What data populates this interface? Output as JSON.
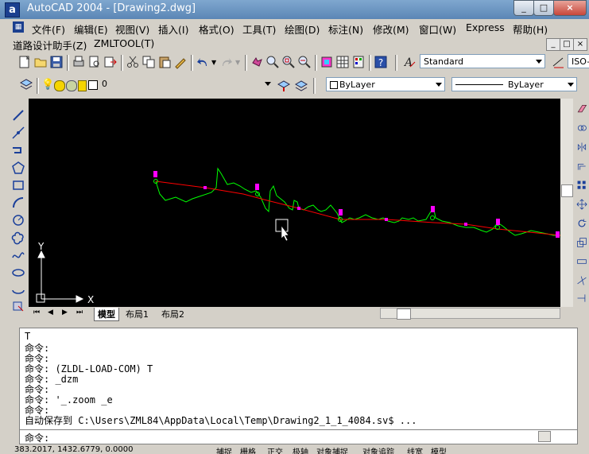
{
  "window": {
    "app_icon": "a",
    "title": "AutoCAD 2004 - [Drawing2.dwg]",
    "controls": [
      "_",
      "□",
      "×"
    ]
  },
  "menubar1": [
    "文件(F)",
    "编辑(E)",
    "视图(V)",
    "插入(I)",
    "格式(O)",
    "工具(T)",
    "绘图(D)",
    "标注(N)",
    "修改(M)",
    "窗口(W)",
    "Express",
    "帮助(H)"
  ],
  "menubar2": [
    "道路设计助手(Z)",
    "ZMLTOOL(T)"
  ],
  "mdi_controls": [
    "_",
    "□",
    "×"
  ],
  "toolbar": {
    "text_style": "Standard",
    "dim_style": "ISO-",
    "layer": "0",
    "color": "ByLayer",
    "linetype": "ByLayer"
  },
  "layout_tabs": [
    "模型",
    "布局1",
    "布局2"
  ],
  "axis": {
    "y": "Y",
    "x": "X"
  },
  "command_history": [
    "T",
    "命令:",
    "命令:",
    "命令: (ZLDL-LOAD-COM) T",
    "命令: _dzm",
    "命令:",
    "命令: '_.zoom _e",
    "命令:",
    "自动保存到 C:\\Users\\ZML84\\AppData\\Local\\Temp\\Drawing2_1_1_4084.sv$ ..."
  ],
  "command_prompt": "命令:",
  "status": {
    "coords": "383.2017, 1432.6779, 0.0000",
    "toggles": [
      "捕捉",
      "栅格",
      "正交",
      "极轴",
      "对象捕捉",
      "对象追踪",
      "线宽",
      "模型"
    ]
  },
  "colors": {
    "drawing_bg": "#000000",
    "profile_line": "#00ff00",
    "design_line": "#ff0000",
    "vertex_marker": "#ff00ff"
  }
}
